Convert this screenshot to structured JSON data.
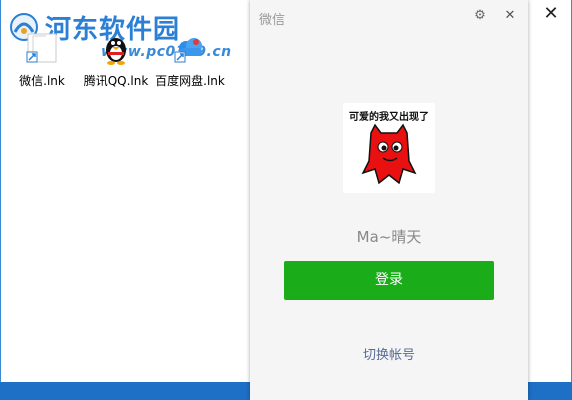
{
  "window": {
    "close_glyph": "✕"
  },
  "watermark": {
    "title": "河东软件园",
    "url": "www.pc0359.cn"
  },
  "desktop_icons": [
    {
      "label": "微信.lnk",
      "icon": "wechat-shortcut-icon"
    },
    {
      "label": "腾讯QQ.lnk",
      "icon": "qq-penguin-icon"
    },
    {
      "label": "百度网盘.lnk",
      "icon": "baidu-cloud-icon"
    }
  ],
  "wechat_login": {
    "title": "微信",
    "settings_glyph": "⚙",
    "close_glyph": "✕",
    "avatar_caption": "可爱的我又出现了",
    "username": "Ma~晴天",
    "login_label": "登录",
    "switch_account_label": "切换帐号",
    "colors": {
      "accent": "#1aad19",
      "link": "#576b95",
      "panel": "#f5f5f5"
    }
  }
}
